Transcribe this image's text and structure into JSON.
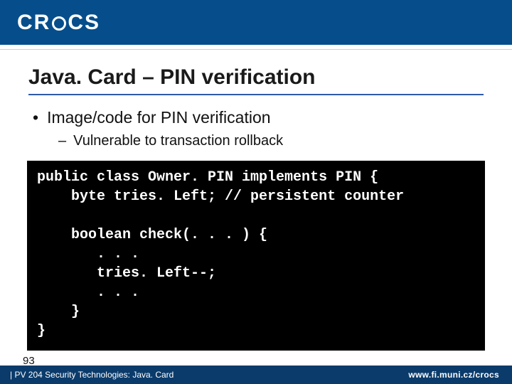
{
  "header": {
    "logo_text_left": "CR",
    "logo_text_right": "CS"
  },
  "slide": {
    "title": "Java. Card – PIN verification",
    "bullets": {
      "l1": "Image/code for PIN verification",
      "l2": "Vulnerable to transaction rollback"
    },
    "code": "public class Owner. PIN implements PIN {\n    byte tries. Left; // persistent counter\n\n    boolean check(. . . ) {\n       . . .\n       tries. Left--;\n       . . .\n    }\n}"
  },
  "footer": {
    "page_number": "93",
    "course": "| PV 204 Security Technologies: Java. Card",
    "url": "www.fi.muni.cz/crocs"
  }
}
